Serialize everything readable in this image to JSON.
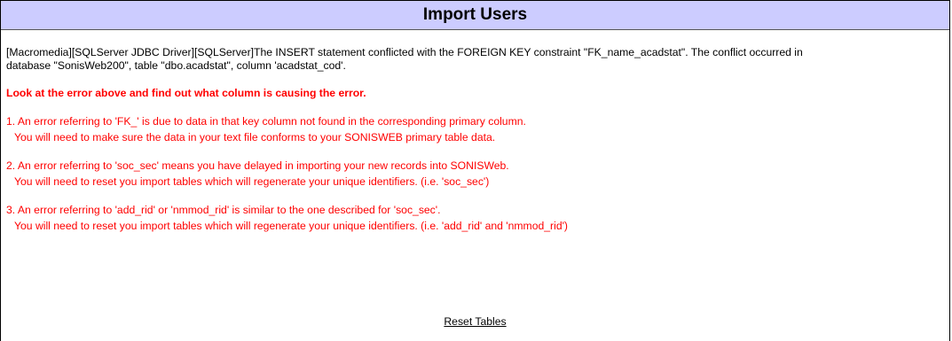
{
  "header": {
    "title": "Import Users"
  },
  "error": {
    "line1": "[Macromedia][SQLServer JDBC Driver][SQLServer]The INSERT statement conflicted with the FOREIGN KEY constraint \"FK_name_acadstat\". The conflict occurred in",
    "line2": "database \"SonisWeb200\", table \"dbo.acadstat\", column 'acadstat_cod'."
  },
  "instruction": "Look at the error above and find out what column is causing the error.",
  "items": [
    {
      "line1": "1. An error referring to 'FK_' is due to data in that key column not found in the corresponding primary column.",
      "line2": "You will need to make sure the data in your text file conforms to your SONISWEB primary table data."
    },
    {
      "line1": "2. An error referring to 'soc_sec' means you have delayed in importing your new records into SONISWeb.",
      "line2": "You will need to reset you import tables which will regenerate your unique identifiers. (i.e. 'soc_sec')"
    },
    {
      "line1": "3. An error referring to 'add_rid' or 'nmmod_rid' is similar to the one described for 'soc_sec'.",
      "line2": "You will need to reset you import tables which will regenerate your unique identifiers. (i.e. 'add_rid' and 'nmmod_rid')"
    }
  ],
  "actions": {
    "reset_label": "Reset Tables"
  },
  "colors": {
    "header_bg": "#ccccff",
    "error_text": "#ff0000"
  }
}
